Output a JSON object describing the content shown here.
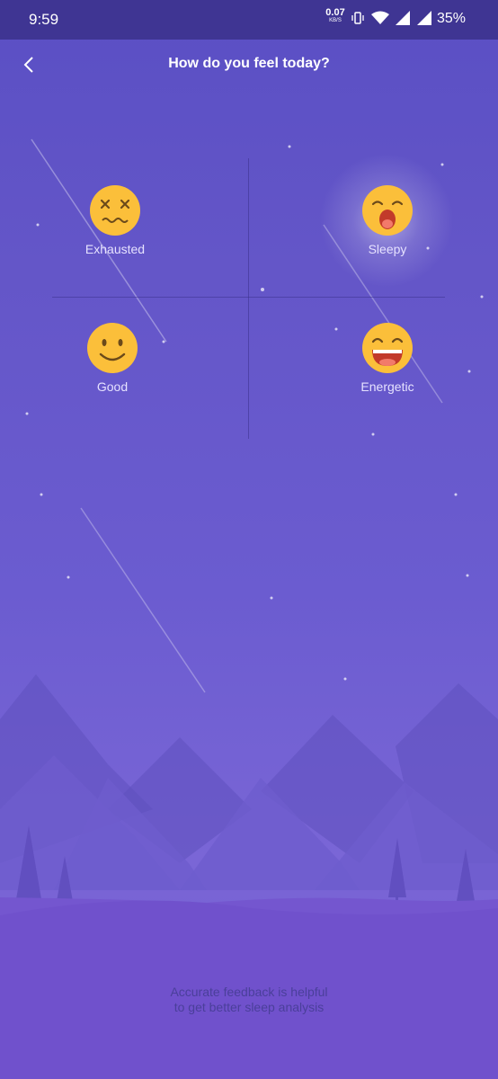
{
  "status_bar": {
    "time": "9:59",
    "net_speed": "0.07",
    "net_unit": "KB/S",
    "battery": "35%"
  },
  "header": {
    "title": "How do you feel today?"
  },
  "moods": [
    {
      "label": "Exhausted",
      "icon": "dizzy-face-icon"
    },
    {
      "label": "Sleepy",
      "icon": "sleepy-face-icon"
    },
    {
      "label": "Good",
      "icon": "smiling-face-icon"
    },
    {
      "label": "Energetic",
      "icon": "grinning-face-icon"
    }
  ],
  "footer": {
    "line1": "Accurate feedback is helpful",
    "line2": "to get better sleep analysis"
  },
  "colors": {
    "status_bar": "#3f3593",
    "background_top": "#5a4fc4",
    "background_bottom": "#7258cf",
    "emoji": "#fbbf3a"
  }
}
